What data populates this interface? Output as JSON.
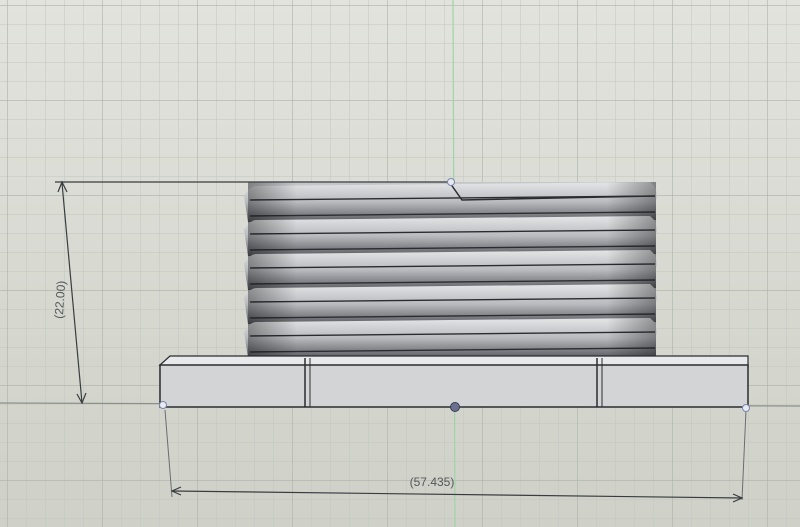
{
  "viewport": {
    "height_dimension": "(22.00)",
    "width_dimension": "(57.435)"
  },
  "colors": {
    "background": "#dcddd6",
    "grid_minor": "#c4c7bf",
    "grid_major": "#b2b5ad",
    "y_axis": "#8fcf9a",
    "model_face": "#c9cbcd",
    "edge": "#2a2c30"
  }
}
